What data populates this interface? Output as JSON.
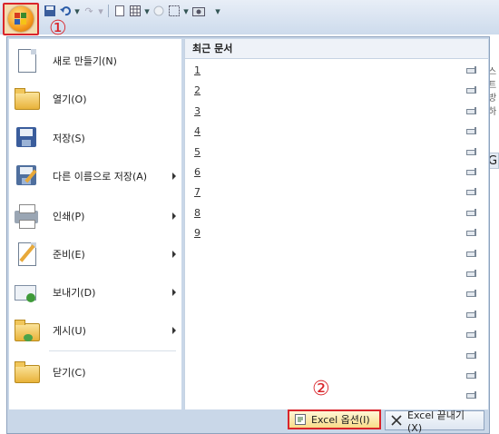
{
  "qat": {
    "icons": [
      "save-icon",
      "undo-icon",
      "redo-icon",
      "new-icon",
      "table-icon",
      "circle-icon",
      "border-icon",
      "camera-icon"
    ]
  },
  "callouts": {
    "one": "①",
    "two": "②"
  },
  "menu": {
    "left_items": [
      {
        "label": "새로 만들기(N)",
        "icon": "new-document-icon",
        "submenu": false
      },
      {
        "label": "열기(O)",
        "icon": "open-folder-icon",
        "submenu": false
      },
      {
        "label": "저장(S)",
        "icon": "save-disk-icon",
        "submenu": false
      },
      {
        "label": "다른 이름으로 저장(A)",
        "icon": "save-as-icon",
        "submenu": true
      },
      {
        "label": "인쇄(P)",
        "icon": "printer-icon",
        "submenu": true
      },
      {
        "label": "준비(E)",
        "icon": "prepare-icon",
        "submenu": true
      },
      {
        "label": "보내기(D)",
        "icon": "send-icon",
        "submenu": true
      },
      {
        "label": "게시(U)",
        "icon": "publish-icon",
        "submenu": true
      },
      {
        "label": "닫기(C)",
        "icon": "close-folder-icon",
        "submenu": false
      }
    ],
    "recent": {
      "title": "최근 문서",
      "numbers": [
        "1",
        "2",
        "3",
        "4",
        "5",
        "6",
        "7",
        "8",
        "9"
      ]
    },
    "buttons": {
      "options": "Excel 옵션(I)",
      "exit": "Excel 끝내기(X)"
    }
  },
  "background": {
    "column_header": "G",
    "fragments": [
      "스트",
      "방하"
    ]
  }
}
